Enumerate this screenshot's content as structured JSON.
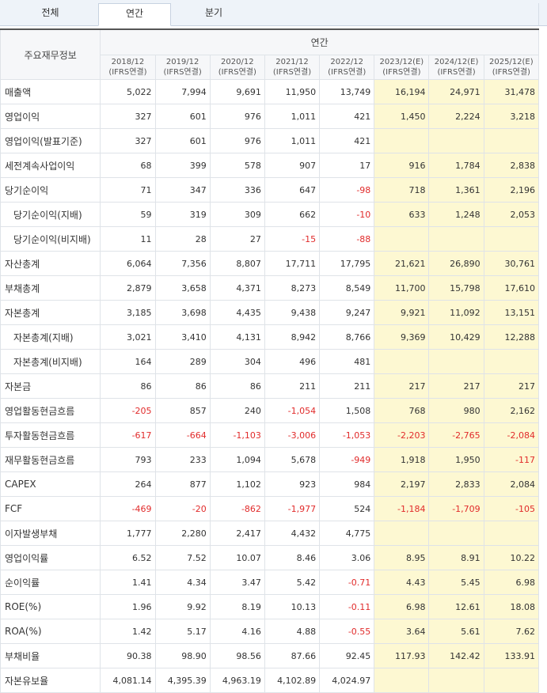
{
  "tabs": [
    "전체",
    "연간",
    "분기"
  ],
  "header": {
    "corner": "주요재무정보",
    "group": "연간",
    "periods": [
      {
        "date": "2018/12",
        "basis": "(IFRS연결)",
        "estimate": false
      },
      {
        "date": "2019/12",
        "basis": "(IFRS연결)",
        "estimate": false
      },
      {
        "date": "2020/12",
        "basis": "(IFRS연결)",
        "estimate": false
      },
      {
        "date": "2021/12",
        "basis": "(IFRS연결)",
        "estimate": false
      },
      {
        "date": "2022/12",
        "basis": "(IFRS연결)",
        "estimate": false
      },
      {
        "date": "2023/12(E)",
        "basis": "(IFRS연결)",
        "estimate": true
      },
      {
        "date": "2024/12(E)",
        "basis": "(IFRS연결)",
        "estimate": true
      },
      {
        "date": "2025/12(E)",
        "basis": "(IFRS연결)",
        "estimate": true
      }
    ]
  },
  "rows": [
    {
      "label": "매출액",
      "sub": false,
      "values": [
        "5,022",
        "7,994",
        "9,691",
        "11,950",
        "13,749",
        "16,194",
        "24,971",
        "31,478"
      ]
    },
    {
      "label": "영업이익",
      "sub": false,
      "values": [
        "327",
        "601",
        "976",
        "1,011",
        "421",
        "1,450",
        "2,224",
        "3,218"
      ]
    },
    {
      "label": "영업이익(발표기준)",
      "sub": false,
      "values": [
        "327",
        "601",
        "976",
        "1,011",
        "421",
        "",
        "",
        ""
      ]
    },
    {
      "label": "세전계속사업이익",
      "sub": false,
      "values": [
        "68",
        "399",
        "578",
        "907",
        "17",
        "916",
        "1,784",
        "2,838"
      ]
    },
    {
      "label": "당기순이익",
      "sub": false,
      "values": [
        "71",
        "347",
        "336",
        "647",
        "-98",
        "718",
        "1,361",
        "2,196"
      ]
    },
    {
      "label": "당기순이익(지배)",
      "sub": true,
      "values": [
        "59",
        "319",
        "309",
        "662",
        "-10",
        "633",
        "1,248",
        "2,053"
      ]
    },
    {
      "label": "당기순이익(비지배)",
      "sub": true,
      "values": [
        "11",
        "28",
        "27",
        "-15",
        "-88",
        "",
        "",
        ""
      ]
    },
    {
      "label": "자산총계",
      "sub": false,
      "values": [
        "6,064",
        "7,356",
        "8,807",
        "17,711",
        "17,795",
        "21,621",
        "26,890",
        "30,761"
      ]
    },
    {
      "label": "부채총계",
      "sub": false,
      "values": [
        "2,879",
        "3,658",
        "4,371",
        "8,273",
        "8,549",
        "11,700",
        "15,798",
        "17,610"
      ]
    },
    {
      "label": "자본총계",
      "sub": false,
      "values": [
        "3,185",
        "3,698",
        "4,435",
        "9,438",
        "9,247",
        "9,921",
        "11,092",
        "13,151"
      ]
    },
    {
      "label": "자본총계(지배)",
      "sub": true,
      "values": [
        "3,021",
        "3,410",
        "4,131",
        "8,942",
        "8,766",
        "9,369",
        "10,429",
        "12,288"
      ]
    },
    {
      "label": "자본총계(비지배)",
      "sub": true,
      "values": [
        "164",
        "289",
        "304",
        "496",
        "481",
        "",
        "",
        ""
      ]
    },
    {
      "label": "자본금",
      "sub": false,
      "values": [
        "86",
        "86",
        "86",
        "211",
        "211",
        "217",
        "217",
        "217"
      ]
    },
    {
      "label": "영업활동현금흐름",
      "sub": false,
      "values": [
        "-205",
        "857",
        "240",
        "-1,054",
        "1,508",
        "768",
        "980",
        "2,162"
      ]
    },
    {
      "label": "투자활동현금흐름",
      "sub": false,
      "values": [
        "-617",
        "-664",
        "-1,103",
        "-3,006",
        "-1,053",
        "-2,203",
        "-2,765",
        "-2,084"
      ]
    },
    {
      "label": "재무활동현금흐름",
      "sub": false,
      "values": [
        "793",
        "233",
        "1,094",
        "5,678",
        "-949",
        "1,918",
        "1,950",
        "-117"
      ]
    },
    {
      "label": "CAPEX",
      "sub": false,
      "values": [
        "264",
        "877",
        "1,102",
        "923",
        "984",
        "2,197",
        "2,833",
        "2,084"
      ]
    },
    {
      "label": "FCF",
      "sub": false,
      "values": [
        "-469",
        "-20",
        "-862",
        "-1,977",
        "524",
        "-1,184",
        "-1,709",
        "-105"
      ]
    },
    {
      "label": "이자발생부채",
      "sub": false,
      "values": [
        "1,777",
        "2,280",
        "2,417",
        "4,432",
        "4,775",
        "",
        "",
        ""
      ]
    },
    {
      "label": "영업이익률",
      "sub": false,
      "values": [
        "6.52",
        "7.52",
        "10.07",
        "8.46",
        "3.06",
        "8.95",
        "8.91",
        "10.22"
      ]
    },
    {
      "label": "순이익률",
      "sub": false,
      "values": [
        "1.41",
        "4.34",
        "3.47",
        "5.42",
        "-0.71",
        "4.43",
        "5.45",
        "6.98"
      ]
    },
    {
      "label": "ROE(%)",
      "sub": false,
      "values": [
        "1.96",
        "9.92",
        "8.19",
        "10.13",
        "-0.11",
        "6.98",
        "12.61",
        "18.08"
      ]
    },
    {
      "label": "ROA(%)",
      "sub": false,
      "values": [
        "1.42",
        "5.17",
        "4.16",
        "4.88",
        "-0.55",
        "3.64",
        "5.61",
        "7.62"
      ]
    },
    {
      "label": "부채비율",
      "sub": false,
      "values": [
        "90.38",
        "98.90",
        "98.56",
        "87.66",
        "92.45",
        "117.93",
        "142.42",
        "133.91"
      ]
    },
    {
      "label": "자본유보율",
      "sub": false,
      "values": [
        "4,081.14",
        "4,395.39",
        "4,963.19",
        "4,102.89",
        "4,024.97",
        "",
        "",
        ""
      ]
    }
  ],
  "colors": {
    "estimate_bg": "#fdf8d2",
    "negative": "#e12b2b"
  }
}
